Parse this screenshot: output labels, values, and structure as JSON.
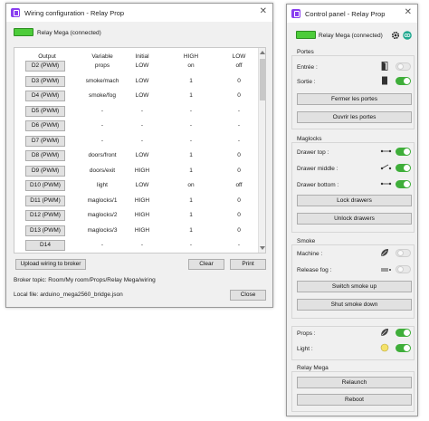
{
  "wiring": {
    "title": "Wiring configuration - Relay Prop",
    "close_glyph": "✕",
    "connection_label": "Relay Mega (connected)",
    "columns": [
      "Output",
      "Variable",
      "Initial",
      "HIGH",
      "LOW"
    ],
    "rows": [
      {
        "output": "D2 (PWM)",
        "variable": "props",
        "initial": "LOW",
        "high": "on",
        "low": "off"
      },
      {
        "output": "D3 (PWM)",
        "variable": "smoke/mach",
        "initial": "LOW",
        "high": "1",
        "low": "0"
      },
      {
        "output": "D4 (PWM)",
        "variable": "smoke/fog",
        "initial": "LOW",
        "high": "1",
        "low": "0"
      },
      {
        "output": "D5 (PWM)",
        "variable": "-",
        "initial": "-",
        "high": "-",
        "low": "-"
      },
      {
        "output": "D6 (PWM)",
        "variable": "-",
        "initial": "-",
        "high": "-",
        "low": "-"
      },
      {
        "output": "D7 (PWM)",
        "variable": "-",
        "initial": "-",
        "high": "-",
        "low": "-"
      },
      {
        "output": "D8 (PWM)",
        "variable": "doors/front",
        "initial": "LOW",
        "high": "1",
        "low": "0"
      },
      {
        "output": "D9 (PWM)",
        "variable": "doors/exit",
        "initial": "HIGH",
        "high": "1",
        "low": "0"
      },
      {
        "output": "D10 (PWM)",
        "variable": "light",
        "initial": "LOW",
        "high": "on",
        "low": "off"
      },
      {
        "output": "D11 (PWM)",
        "variable": "maglocks/1",
        "initial": "HIGH",
        "high": "1",
        "low": "0"
      },
      {
        "output": "D12 (PWM)",
        "variable": "maglocks/2",
        "initial": "HIGH",
        "high": "1",
        "low": "0"
      },
      {
        "output": "D13 (PWM)",
        "variable": "maglocks/3",
        "initial": "HIGH",
        "high": "1",
        "low": "0"
      },
      {
        "output": "D14",
        "variable": "-",
        "initial": "-",
        "high": "-",
        "low": "-"
      }
    ],
    "upload_button": "Upload wiring to broker",
    "clear_button": "Clear",
    "print_button": "Print",
    "broker_topic": "Broker topic:  Room/My room/Props/Relay Mega/wiring",
    "local_file": "Local file:   arduino_mega2560_bridge.json",
    "close_button": "Close"
  },
  "control": {
    "title": "Control panel - Relay Prop",
    "close_glyph": "✕",
    "connection_label": "Relay Mega (connected)",
    "portes": {
      "title": "Portes",
      "entree_label": "Entrée :",
      "entree_on": false,
      "sortie_label": "Sortie :",
      "sortie_on": true,
      "close_doors": "Fermer les portes",
      "open_doors": "Ouvrir les portes"
    },
    "maglocks": {
      "title": "Maglocks",
      "top_label": "Drawer top :",
      "top_on": true,
      "middle_label": "Drawer middle :",
      "middle_on": true,
      "bottom_label": "Drawer bottom :",
      "bottom_on": true,
      "lock_drawers": "Lock drawers",
      "unlock_drawers": "Unlock drawers"
    },
    "smoke": {
      "title": "Smoke",
      "machine_label": "Machine :",
      "machine_on": false,
      "release_label": "Release fog :",
      "release_on": false,
      "switch_up": "Switch smoke up",
      "shut_down": "Shut smoke down"
    },
    "misc": {
      "props_label": "Props :",
      "props_on": true,
      "light_label": "Light :",
      "light_on": true
    },
    "relay": {
      "title": "Relay Mega",
      "relaunch": "Relaunch",
      "reboot": "Reboot"
    },
    "colors": {
      "accent": "#3fae3a",
      "led": "#4dcc3a",
      "app_icon": "#8a3ff0"
    }
  }
}
